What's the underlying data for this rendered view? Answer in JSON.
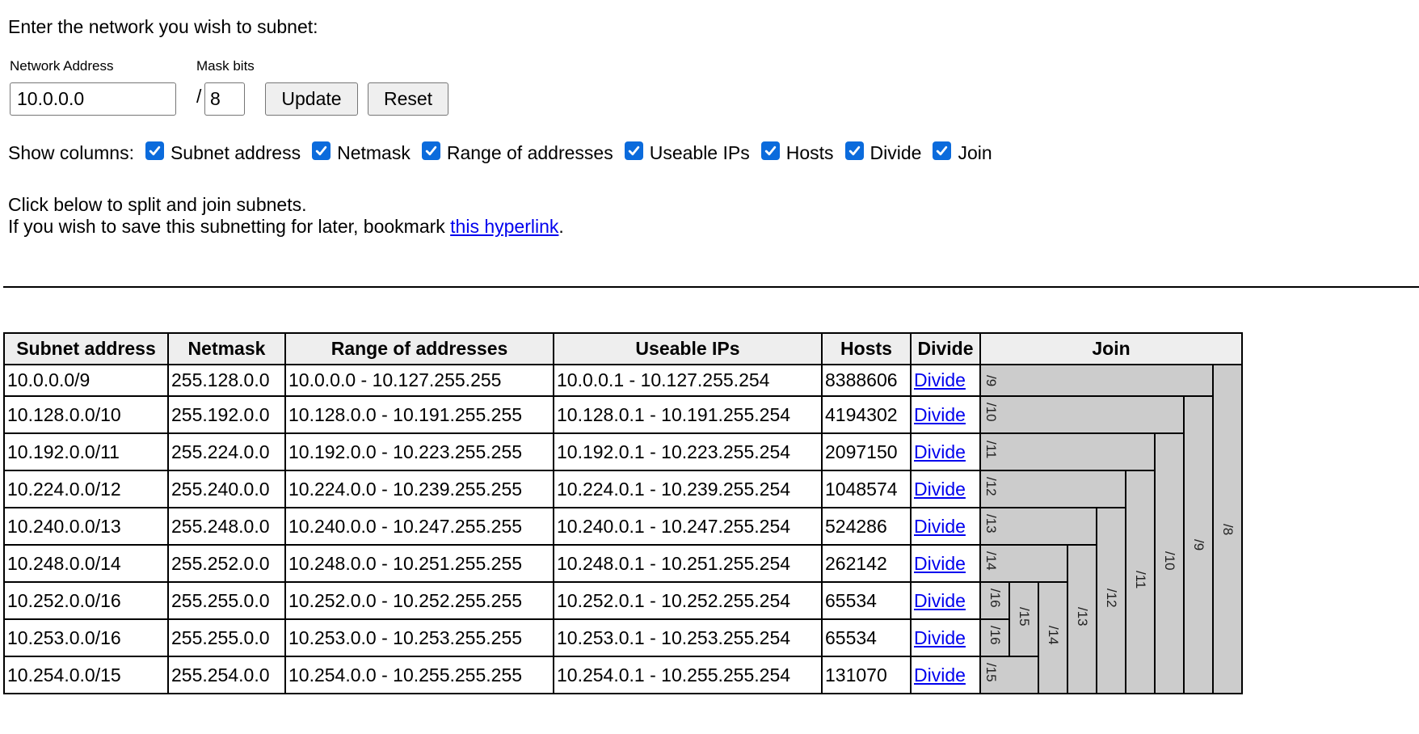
{
  "intro": "Enter the network you wish to subnet:",
  "form": {
    "network_label": "Network Address",
    "mask_label": "Mask bits",
    "network_value": "10.0.0.0",
    "slash": "/",
    "mask_value": "8",
    "update_label": "Update",
    "reset_label": "Reset"
  },
  "show_columns": {
    "label": "Show columns:",
    "options": [
      {
        "label": "Subnet address",
        "checked": true
      },
      {
        "label": "Netmask",
        "checked": true
      },
      {
        "label": "Range of addresses",
        "checked": true
      },
      {
        "label": "Useable IPs",
        "checked": true
      },
      {
        "label": "Hosts",
        "checked": true
      },
      {
        "label": "Divide",
        "checked": true
      },
      {
        "label": "Join",
        "checked": true
      }
    ]
  },
  "help": {
    "line1": "Click below to split and join subnets.",
    "line2_prefix": "If you wish to save this subnetting for later, bookmark ",
    "link_text": "this hyperlink",
    "line2_suffix": "."
  },
  "table": {
    "headers": [
      "Subnet address",
      "Netmask",
      "Range of addresses",
      "Useable IPs",
      "Hosts",
      "Divide",
      "Join"
    ],
    "rows": [
      {
        "subnet": "10.0.0.0/9",
        "netmask": "255.128.0.0",
        "range": "10.0.0.0 - 10.127.255.255",
        "useable": "10.0.0.1 - 10.127.255.254",
        "hosts": "8388606",
        "divide": "Divide"
      },
      {
        "subnet": "10.128.0.0/10",
        "netmask": "255.192.0.0",
        "range": "10.128.0.0 - 10.191.255.255",
        "useable": "10.128.0.1 - 10.191.255.254",
        "hosts": "4194302",
        "divide": "Divide"
      },
      {
        "subnet": "10.192.0.0/11",
        "netmask": "255.224.0.0",
        "range": "10.192.0.0 - 10.223.255.255",
        "useable": "10.192.0.1 - 10.223.255.254",
        "hosts": "2097150",
        "divide": "Divide"
      },
      {
        "subnet": "10.224.0.0/12",
        "netmask": "255.240.0.0",
        "range": "10.224.0.0 - 10.239.255.255",
        "useable": "10.224.0.1 - 10.239.255.254",
        "hosts": "1048574",
        "divide": "Divide"
      },
      {
        "subnet": "10.240.0.0/13",
        "netmask": "255.248.0.0",
        "range": "10.240.0.0 - 10.247.255.255",
        "useable": "10.240.0.1 - 10.247.255.254",
        "hosts": "524286",
        "divide": "Divide"
      },
      {
        "subnet": "10.248.0.0/14",
        "netmask": "255.252.0.0",
        "range": "10.248.0.0 - 10.251.255.255",
        "useable": "10.248.0.1 - 10.251.255.254",
        "hosts": "262142",
        "divide": "Divide"
      },
      {
        "subnet": "10.252.0.0/16",
        "netmask": "255.255.0.0",
        "range": "10.252.0.0 - 10.252.255.255",
        "useable": "10.252.0.1 - 10.252.255.254",
        "hosts": "65534",
        "divide": "Divide"
      },
      {
        "subnet": "10.253.0.0/16",
        "netmask": "255.255.0.0",
        "range": "10.253.0.0 - 10.253.255.255",
        "useable": "10.253.0.1 - 10.253.255.254",
        "hosts": "65534",
        "divide": "Divide"
      },
      {
        "subnet": "10.254.0.0/15",
        "netmask": "255.254.0.0",
        "range": "10.254.0.0 - 10.255.255.255",
        "useable": "10.254.0.1 - 10.255.255.254",
        "hosts": "131070",
        "divide": "Divide"
      }
    ],
    "join": {
      "r0": [
        "/9",
        "/8"
      ],
      "r1": [
        "/10",
        "/9"
      ],
      "r2": [
        "/11",
        "/10"
      ],
      "r3": [
        "/12",
        "/11"
      ],
      "r4": [
        "/13",
        "/12"
      ],
      "r5": [
        "/14",
        "/13"
      ],
      "r6": [
        "/16",
        "/15",
        "/14"
      ],
      "r7": [
        "/16"
      ],
      "r8": [
        "/15"
      ]
    }
  },
  "colors": {
    "link": "#0000ee",
    "checkbox": "#0b6bdc",
    "header_bg": "#eeeeee",
    "join_bg": "#cccccc"
  }
}
